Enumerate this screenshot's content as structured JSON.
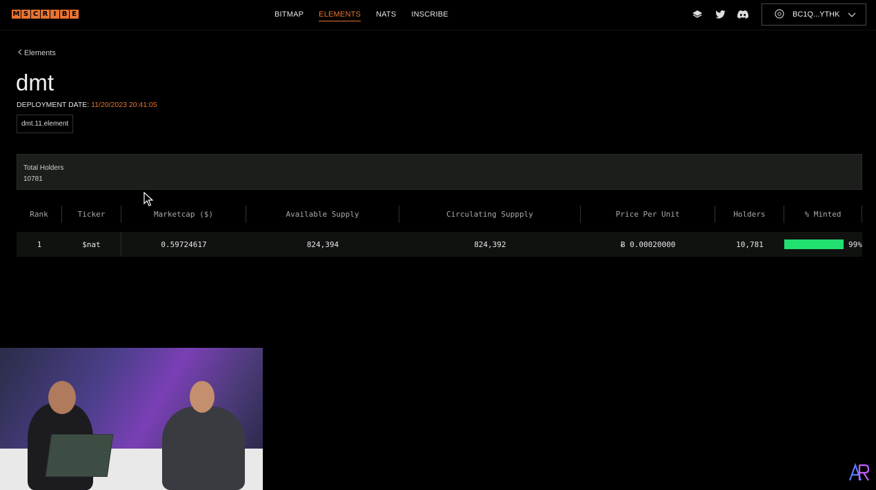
{
  "header": {
    "logo_letters": [
      "M",
      "S",
      "C",
      "R",
      "I",
      "B",
      "E"
    ],
    "nav": [
      {
        "label": "BITMAP",
        "active": false
      },
      {
        "label": "ELEMENTS",
        "active": true
      },
      {
        "label": "NATS",
        "active": false
      },
      {
        "label": "INSCRIBE",
        "active": false
      }
    ],
    "social_icons": [
      "stack-icon",
      "twitter-icon",
      "discord-icon"
    ],
    "wallet_label": "BC1Q...YTHK"
  },
  "page": {
    "back_label": "Elements",
    "title": "dmt",
    "deployment_label": "DEPLOYMENT DATE:",
    "deployment_date": "11/20/2023 20:41:05",
    "tag": "dmt.11.element"
  },
  "holders_panel": {
    "label": "Total Holders",
    "value": "10781"
  },
  "table": {
    "headers": [
      "Rank",
      "Ticker",
      "Marketcap ($)",
      "Available Supply",
      "Circulating Suppply",
      "Price Per Unit",
      "Holders",
      "% Minted"
    ],
    "rows": [
      {
        "rank": "1",
        "ticker": "$nat",
        "marketcap": "0.59724617",
        "available_supply": "824,394",
        "circulating_supply": "824,392",
        "price": "Ƀ 0.00020000",
        "holders": "10,781",
        "minted_pct": "99%",
        "minted_fraction": 0.99
      }
    ]
  },
  "colors": {
    "accent": "#e8742f",
    "minted_bar": "#22e06f",
    "background": "#000000"
  }
}
